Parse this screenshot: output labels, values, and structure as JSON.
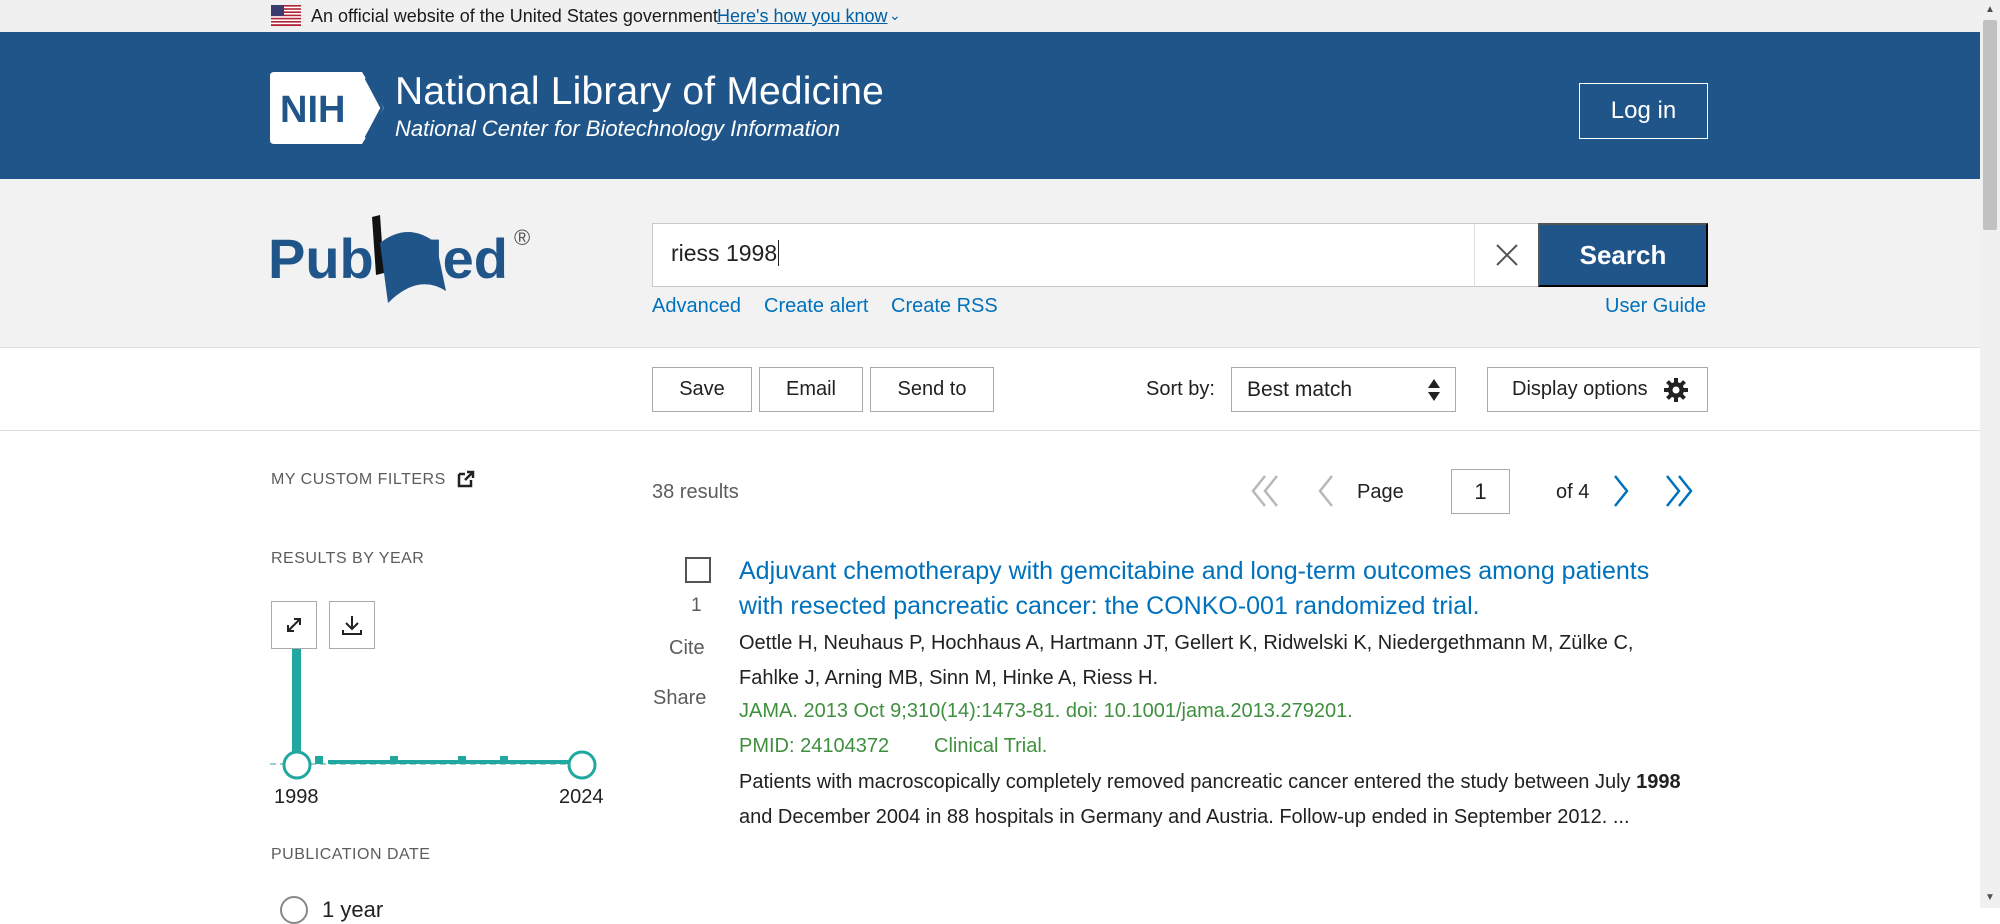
{
  "gov_banner": {
    "text": "An official website of the United States government",
    "link": "Here's how you know"
  },
  "header": {
    "title": "National Library of Medicine",
    "subtitle": "National Center for Biotechnology Information",
    "login": "Log in",
    "logo_text": "NIH"
  },
  "search": {
    "logo_text": "PubMed",
    "query": "riess 1998",
    "button": "Search",
    "links": [
      "Advanced",
      "Create alert",
      "Create RSS"
    ],
    "user_guide": "User Guide"
  },
  "toolbar": {
    "save": "Save",
    "email": "Email",
    "send_to": "Send to",
    "sort_label": "Sort by:",
    "sort_value": "Best match",
    "display_options": "Display options"
  },
  "sidebar": {
    "custom_filters": "MY CUSTOM FILTERS",
    "results_by_year": "RESULTS BY YEAR",
    "year_start": "1998",
    "year_end": "2024",
    "publication_date": "PUBLICATION DATE",
    "pub_date_first_option": "1 year"
  },
  "results": {
    "count": "38 results",
    "page_label": "Page",
    "page_value": "1",
    "page_of": "of 4",
    "items": [
      {
        "number": "1",
        "cite": "Cite",
        "share": "Share",
        "title": "Adjuvant chemotherapy with gemcitabine and long-term outcomes among patients with resected pancreatic cancer: the CONKO-001 randomized trial.",
        "authors": "Oettle H, Neuhaus P, Hochhaus A, Hartmann JT, Gellert K, Ridwelski K, Niedergethmann M, Zülke C, Fahlke J, Arning MB, Sinn M, Hinke A, Riess H.",
        "citation": "JAMA. 2013 Oct 9;310(14):1473-81. doi: 10.1001/jama.2013.279201.",
        "pmid": "PMID: 24104372",
        "type": "Clinical Trial.",
        "snippet_before": "Patients with macroscopically completely removed pancreatic cancer entered the study between July ",
        "snippet_bold": "1998",
        "snippet_after": " and December 2004 in 88 hospitals in Germany and Austria. Follow-up ended in September 2012. ..."
      }
    ]
  },
  "colors": {
    "nih_blue": "#20558a",
    "link_blue": "#0071bc",
    "citation_green": "#3f8f3f",
    "chart_teal": "#20a8a0"
  }
}
